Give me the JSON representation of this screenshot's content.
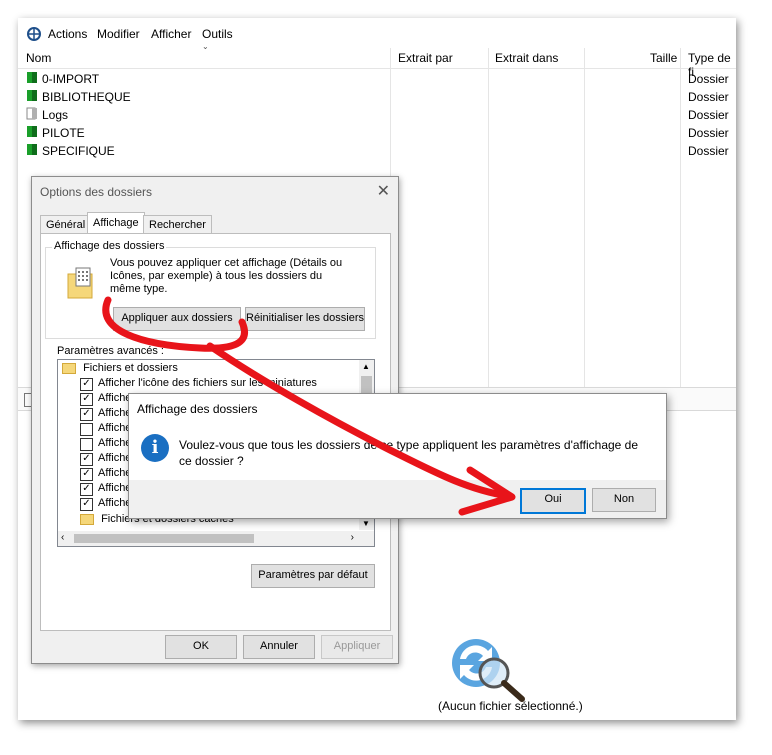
{
  "menubar": {
    "items": [
      "Actions",
      "Modifier",
      "Afficher",
      "Outils"
    ]
  },
  "columns": [
    "Nom",
    "Extrait par",
    "Extrait dans",
    "Taille",
    "Type de fi"
  ],
  "files": [
    {
      "name": "0-IMPORT",
      "type": "Dossier",
      "color": "#1a9f2a"
    },
    {
      "name": "BIBLIOTHEQUE",
      "type": "Dossier",
      "color": "#1a9f2a"
    },
    {
      "name": "Logs",
      "type": "Dossier",
      "color": "#8a8a8a"
    },
    {
      "name": "PILOTE",
      "type": "Dossier",
      "color": "#1a9f2a"
    },
    {
      "name": "SPECIFIQUE",
      "type": "Dossier",
      "color": "#1a9f2a"
    }
  ],
  "preview": {
    "status": "(Aucun fichier sélectionné.)"
  },
  "folder_options": {
    "title": "Options des dossiers",
    "tabs": [
      "Général",
      "Affichage",
      "Rechercher"
    ],
    "group_legend": "Affichage des dossiers",
    "group_text": "Vous pouvez appliquer cet affichage (Détails ou Icônes, par exemple) à tous les dossiers du même type.",
    "apply_button": "Appliquer aux dossiers",
    "reset_button": "Réinitialiser les dossiers",
    "advanced_label": "Paramètres avancés :",
    "tree_root": "Fichiers et dossiers",
    "tree_first": "Afficher l'icône des fichiers sur les miniatures",
    "tree_item": "Afficher",
    "tree_last": "Fichiers et dossiers cachés",
    "checks": [
      true,
      true,
      true,
      false,
      false,
      true,
      true,
      true,
      true
    ],
    "defaults_button": "Paramètres par défaut",
    "ok": "OK",
    "cancel": "Annuler",
    "apply": "Appliquer"
  },
  "message": {
    "title": "Affichage des dossiers",
    "text": "Voulez-vous que tous les dossiers de ce type appliquent les paramètres d'affichage de ce dossier ?",
    "yes": "Oui",
    "no": "Non"
  },
  "colors": {
    "accent": "#1a6fc2",
    "annotation": "#e8141a"
  }
}
